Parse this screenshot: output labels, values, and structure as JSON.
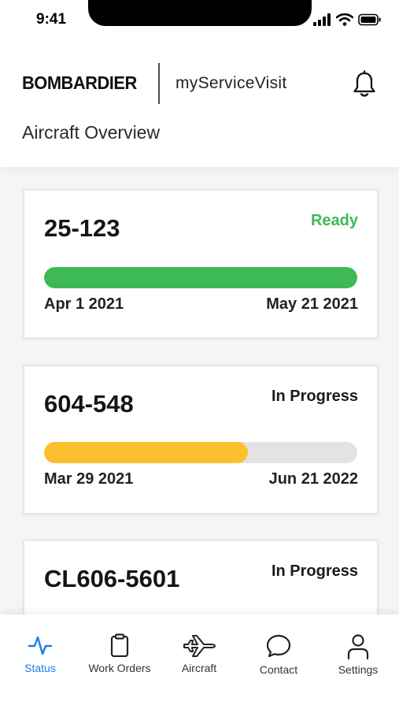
{
  "status_bar": {
    "time": "9:41"
  },
  "header": {
    "brand": "BOMBARDIER",
    "app_name": "myServiceVisit",
    "page_title": "Aircraft Overview"
  },
  "colors": {
    "ready": "#3dba55",
    "in_progress_fill": "#fbc02d",
    "track": "#e3e3e3",
    "active_tab": "#1a7fe6"
  },
  "cards": [
    {
      "registration": "25-123",
      "status": "Ready",
      "progress": 1.0,
      "start_date": "Apr 1 2021",
      "end_date": "May 21 2021"
    },
    {
      "registration": "604-548",
      "status": "In Progress",
      "progress": 0.65,
      "start_date": "Mar 29 2021",
      "end_date": "Jun 21 2022"
    },
    {
      "registration": "CL606-5601",
      "status": "In Progress"
    }
  ],
  "tabs": [
    {
      "label": "Status",
      "icon": "activity-icon",
      "active": true
    },
    {
      "label": "Work Orders",
      "icon": "clipboard-icon",
      "active": false
    },
    {
      "label": "Aircraft",
      "icon": "airplane-icon",
      "active": false
    },
    {
      "label": "Contact",
      "icon": "chat-bubble-icon",
      "active": false
    },
    {
      "label": "Settings",
      "icon": "person-icon",
      "active": false
    }
  ]
}
